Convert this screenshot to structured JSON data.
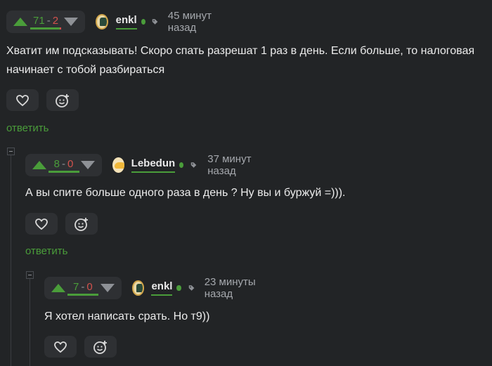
{
  "colors": {
    "accent": "#4a9d3a",
    "minus": "#d2524d",
    "background": "#222426",
    "panel": "#2e3033"
  },
  "reply_label": "ответить",
  "comments": [
    {
      "rating": {
        "plus": "71",
        "minus": "2",
        "separator": "-"
      },
      "author": "enkl",
      "time": "45 минут назад",
      "text_lines": [
        "Хватит им подсказывать! Скоро спать разрешат 1 раз в день. Если больше, то налоговая",
        "начинает с тобой разбираться"
      ]
    },
    {
      "rating": {
        "plus": "8",
        "minus": "0",
        "separator": "-"
      },
      "author": "Lebedun",
      "time": "37 минут назад",
      "text_lines": [
        "А вы спите больше одного раза в день ? Ну вы и буржуй =)))."
      ]
    },
    {
      "rating": {
        "plus": "7",
        "minus": "0",
        "separator": "-"
      },
      "author": "enkl",
      "time": "23 минуты назад",
      "text_lines": [
        "Я хотел написать срать. Но т9))"
      ]
    }
  ]
}
